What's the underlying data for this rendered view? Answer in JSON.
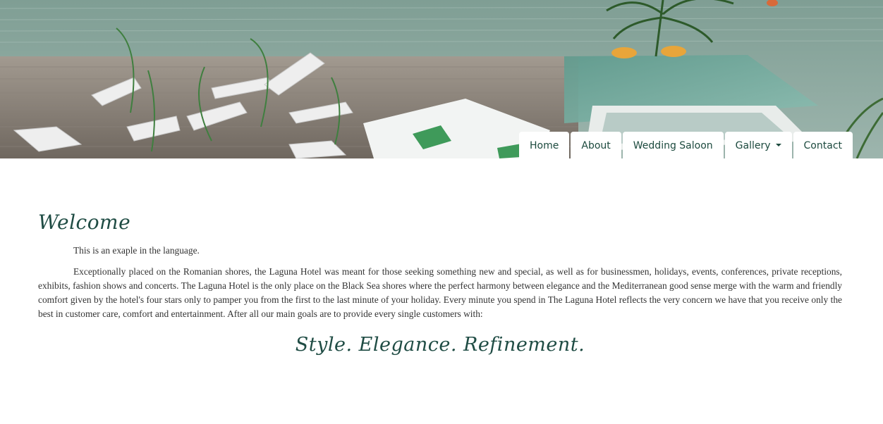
{
  "hero": {
    "image_alt_name": "hotel-terrace-photo"
  },
  "nav": {
    "items": [
      {
        "label": "Home"
      },
      {
        "label": "About"
      },
      {
        "label": "Wedding Saloon"
      },
      {
        "label": "Gallery",
        "has_dropdown": true
      },
      {
        "label": "Contact"
      }
    ]
  },
  "main": {
    "title": "Welcome",
    "intro": "This is an exaple in the language.",
    "body": "Exceptionally placed on the Romanian shores, the Laguna Hotel was meant for those seeking something new and special, as well as for businessmen, holidays, events, conferences, private receptions, exhibits, fashion shows and concerts. The Laguna Hotel is the only place on the Black Sea shores where the perfect harmony between elegance and the Mediterranean good sense merge with the warm and friendly comfort given by the hotel's four stars only to pamper you from the first to the last minute of your holiday. Every minute you spend in The Laguna Hotel reflects the very concern we have that you receive only the best in customer care, comfort and entertainment. After all our main goals are to provide every single customers with:",
    "tagline": "Style. Elegance. Refinement."
  },
  "colors": {
    "accent": "#1f4c44",
    "nav_text": "#1c4a3e",
    "body_text": "#333333",
    "background": "#ffffff"
  }
}
